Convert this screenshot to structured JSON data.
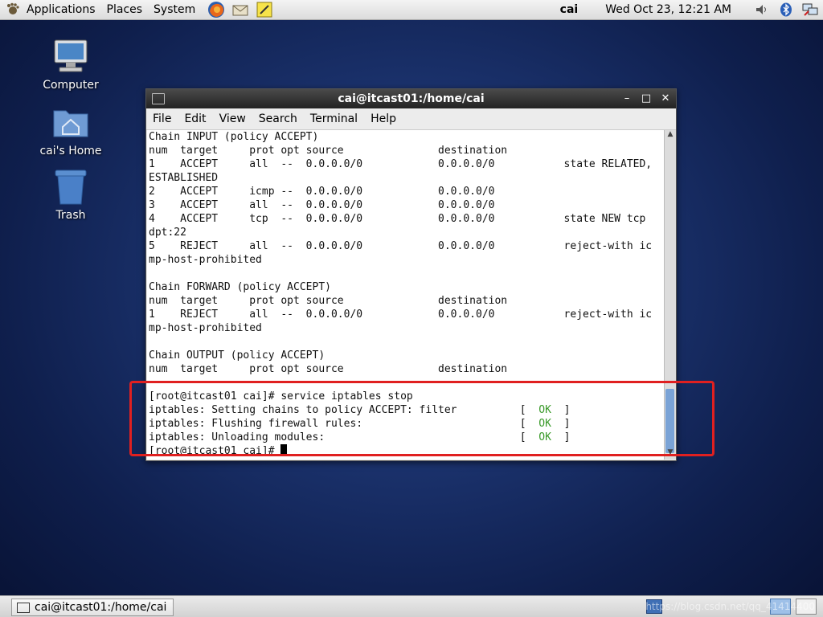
{
  "top_panel": {
    "menus": [
      "Applications",
      "Places",
      "System"
    ],
    "user": "cai",
    "clock": "Wed Oct 23, 12:21 AM"
  },
  "desktop_icons": [
    {
      "label": "Computer"
    },
    {
      "label": "cai's Home"
    },
    {
      "label": "Trash"
    }
  ],
  "window": {
    "title": "cai@itcast01:/home/cai",
    "menus": [
      "File",
      "Edit",
      "View",
      "Search",
      "Terminal",
      "Help"
    ]
  },
  "terminal": {
    "lines": [
      "Chain INPUT (policy ACCEPT)",
      "num  target     prot opt source               destination",
      "1    ACCEPT     all  --  0.0.0.0/0            0.0.0.0/0           state RELATED,",
      "ESTABLISHED",
      "2    ACCEPT     icmp --  0.0.0.0/0            0.0.0.0/0",
      "3    ACCEPT     all  --  0.0.0.0/0            0.0.0.0/0",
      "4    ACCEPT     tcp  --  0.0.0.0/0            0.0.0.0/0           state NEW tcp",
      "dpt:22",
      "5    REJECT     all  --  0.0.0.0/0            0.0.0.0/0           reject-with ic",
      "mp-host-prohibited",
      "",
      "Chain FORWARD (policy ACCEPT)",
      "num  target     prot opt source               destination",
      "1    REJECT     all  --  0.0.0.0/0            0.0.0.0/0           reject-with ic",
      "mp-host-prohibited",
      "",
      "Chain OUTPUT (policy ACCEPT)",
      "num  target     prot opt source               destination",
      "",
      "[root@itcast01 cai]# service iptables stop"
    ],
    "status_lines": [
      {
        "text": "iptables: Setting chains to policy ACCEPT: filter          [  ",
        "ok": "OK",
        "end": "  ]"
      },
      {
        "text": "iptables: Flushing firewall rules:                         [  ",
        "ok": "OK",
        "end": "  ]"
      },
      {
        "text": "iptables: Unloading modules:                               [  ",
        "ok": "OK",
        "end": "  ]"
      }
    ],
    "prompt": "[root@itcast01 cai]# "
  },
  "taskbar": {
    "task_label": "cai@itcast01:/home/cai",
    "watermark": "https://blog.csdn.net/qq_41414400"
  }
}
